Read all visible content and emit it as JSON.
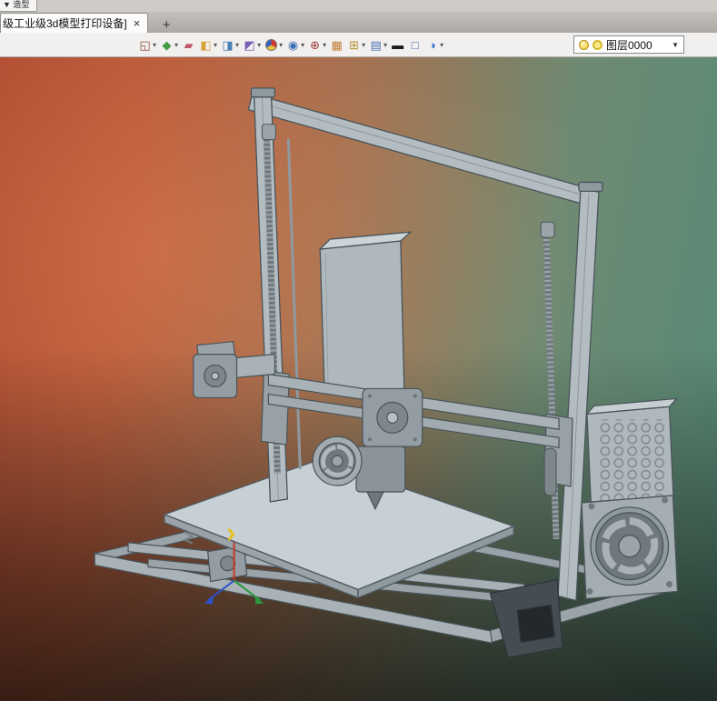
{
  "titlebar": {
    "fragment": "▼ 造型"
  },
  "tabbar": {
    "tab_title": "级工业级3d模型打印设备]",
    "close": "×",
    "new_tab": "+"
  },
  "toolbar": {
    "caret": "▾",
    "icons": [
      {
        "name": "view-window-icon",
        "glyph": "◱"
      },
      {
        "name": "material-icon",
        "glyph": "◆"
      },
      {
        "name": "paint-icon",
        "glyph": "▰"
      },
      {
        "name": "shaded-display-icon",
        "glyph": "◧"
      },
      {
        "name": "wireframe-display-icon",
        "glyph": "◨"
      },
      {
        "name": "hidden-line-display-icon",
        "glyph": "◩"
      },
      {
        "name": "color-wheel-icon",
        "glyph": ""
      },
      {
        "name": "appearance-icon",
        "glyph": "◉"
      },
      {
        "name": "orientation-icon",
        "glyph": "⊕"
      },
      {
        "name": "texture-icon",
        "glyph": "▦"
      },
      {
        "name": "grid-icon",
        "glyph": "⊞"
      },
      {
        "name": "camera-icon",
        "glyph": "▤"
      },
      {
        "name": "background-dark-icon",
        "glyph": "▬"
      },
      {
        "name": "background-light-icon",
        "glyph": "□"
      },
      {
        "name": "lens-icon",
        "glyph": "◑"
      }
    ],
    "layer_combo": {
      "label": "图层0000",
      "caret": "▼"
    }
  },
  "colors": {
    "viewport_top_left": "#a8462f",
    "viewport_top_right": "#558a77",
    "model_gray": "#b2bcc1",
    "axis_red": "#cc3424",
    "axis_green": "#2a9a3a",
    "axis_blue": "#3050c8",
    "marker_yellow": "#e6c120"
  }
}
